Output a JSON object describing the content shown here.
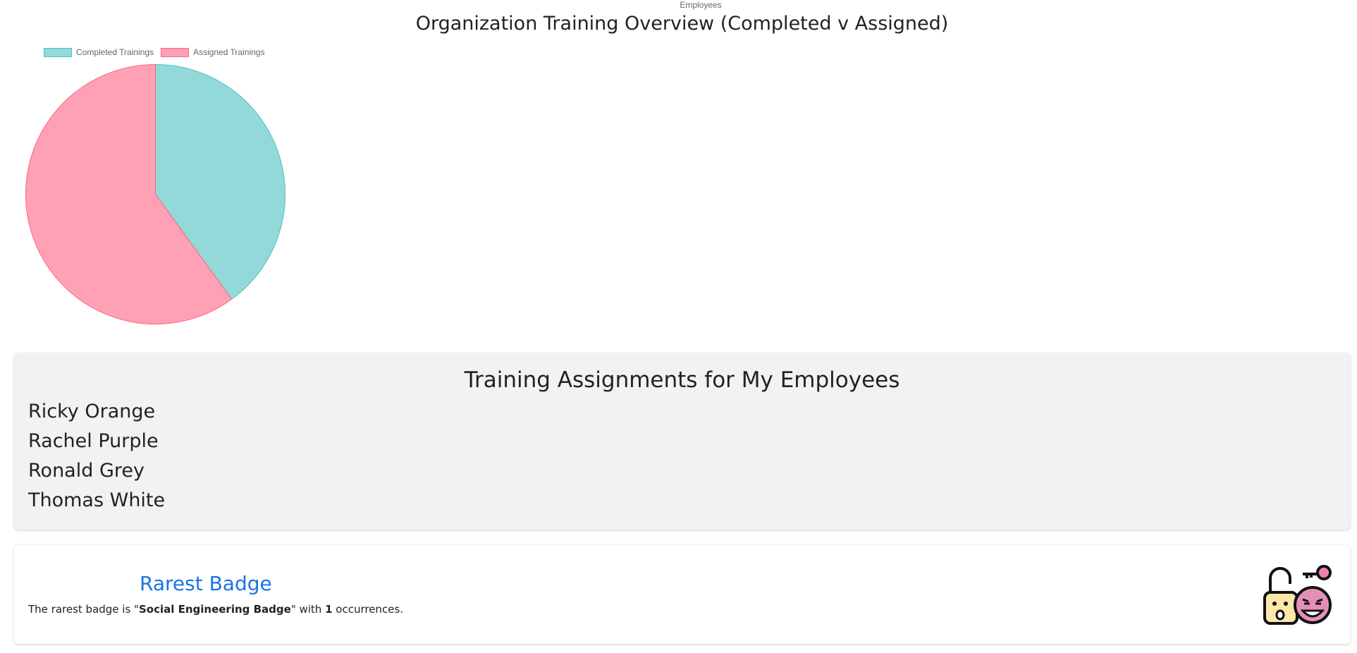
{
  "chart": {
    "top_label": "Employees",
    "title": "Organization Training Overview (Completed v Assigned)"
  },
  "chart_data": {
    "type": "pie",
    "title": "Organization Training Overview (Completed v Assigned)",
    "categories": [
      "Completed Trainings",
      "Assigned Trainings"
    ],
    "values": [
      40,
      60
    ],
    "colors": [
      "#94d9d9",
      "#ffa1b4"
    ],
    "border_colors": [
      "#4bc0c0",
      "#ff6384"
    ],
    "legend_position": "top-left"
  },
  "employees": {
    "heading": "Training Assignments for My Employees",
    "names": [
      "Ricky Orange",
      "Rachel Purple",
      "Ronald Grey",
      "Thomas White"
    ]
  },
  "badge": {
    "heading": "Rarest Badge",
    "sentence_prefix": "The rarest badge is \"",
    "badge_name": "Social Engineering Badge",
    "sentence_middle": "\" with ",
    "count": "1",
    "sentence_suffix": " occurrences.",
    "icon": "social-engineering-icon"
  }
}
